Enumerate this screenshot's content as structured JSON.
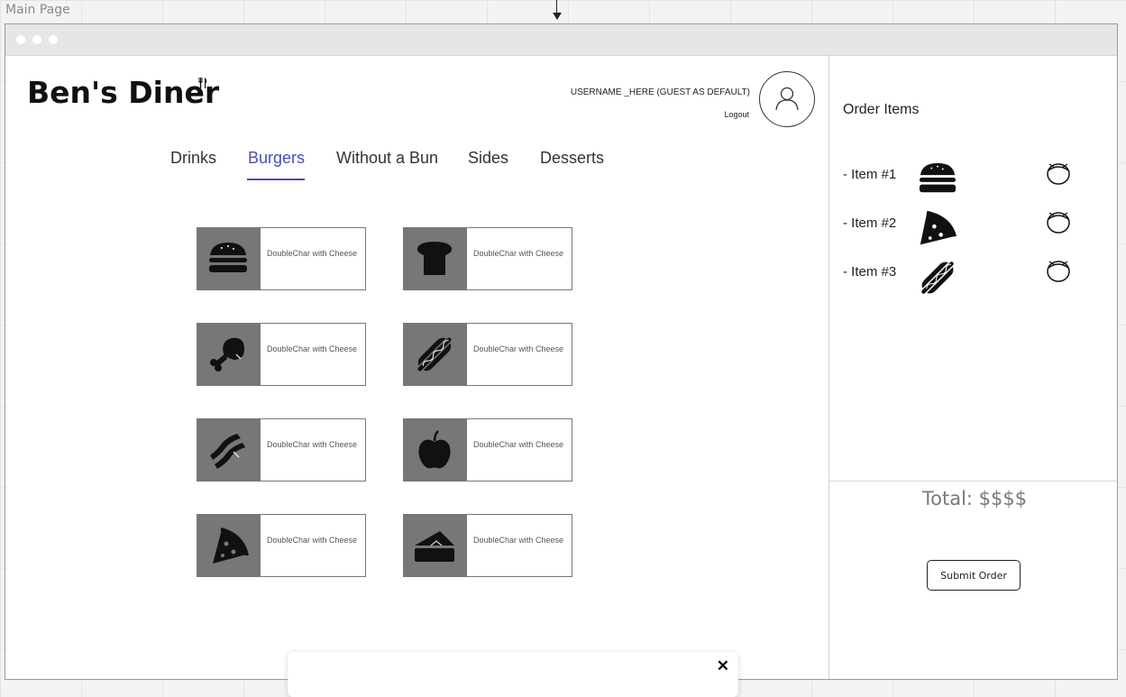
{
  "canvas": {
    "label": "Main Page"
  },
  "header": {
    "logo_text": "Ben's Diner",
    "username": "USERNAME _HERE (GUEST AS DEFAULT)",
    "logout": "Logout"
  },
  "tabs": [
    {
      "label": "Drinks",
      "active": false
    },
    {
      "label": "Burgers",
      "active": true
    },
    {
      "label": "Without a Bun",
      "active": false
    },
    {
      "label": "Sides",
      "active": false
    },
    {
      "label": "Desserts",
      "active": false
    }
  ],
  "menu_items": [
    {
      "icon": "burger-icon",
      "label": "DoubleChar with Cheese"
    },
    {
      "icon": "bread-icon",
      "label": "DoubleChar with Cheese"
    },
    {
      "icon": "drumstick-icon",
      "label": "DoubleChar with Cheese"
    },
    {
      "icon": "hotdog-icon",
      "label": "DoubleChar with Cheese"
    },
    {
      "icon": "bacon-icon",
      "label": "DoubleChar with Cheese"
    },
    {
      "icon": "apple-icon",
      "label": "DoubleChar with Cheese"
    },
    {
      "icon": "pizza-icon",
      "label": "DoubleChar with Cheese"
    },
    {
      "icon": "cake-icon",
      "label": "DoubleChar with Cheese"
    }
  ],
  "order": {
    "title": "Order Items",
    "items": [
      {
        "label": "- Item #1",
        "icon": "burger-icon"
      },
      {
        "label": "- Item #2",
        "icon": "pizza-icon"
      },
      {
        "label": "- Item #3",
        "icon": "hotdog-icon"
      }
    ],
    "total": "Total: $$$$",
    "submit": "Submit Order"
  },
  "popup": {
    "close": "✕",
    "text": ""
  },
  "colors": {
    "accent": "#4b4db5",
    "tile": "#777777",
    "icon": "#111111"
  }
}
